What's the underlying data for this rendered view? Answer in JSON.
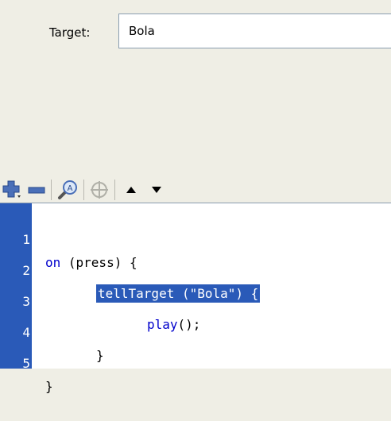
{
  "target": {
    "label": "Target:",
    "value": "Bola"
  },
  "toolbar": {
    "buttons": [
      "add-icon",
      "remove-icon",
      "find-icon",
      "crosshair-icon",
      "arrow-up-icon",
      "arrow-down-icon"
    ]
  },
  "code": {
    "line_numbers": [
      "1",
      "2",
      "3",
      "4",
      "5"
    ],
    "line1": {
      "kw": "on",
      "rest": " (press) {"
    },
    "line2": {
      "text": "tellTarget (\"Bola\") {"
    },
    "line3": {
      "kw": "play",
      "rest": "();"
    },
    "line4": {
      "text": "}"
    },
    "line5": {
      "text": "}"
    }
  },
  "colors": {
    "panel_bg": "#efeee5",
    "gutter_bg": "#2a5ab8",
    "keyword": "#0000cc",
    "selection": "#2a5ab8"
  }
}
